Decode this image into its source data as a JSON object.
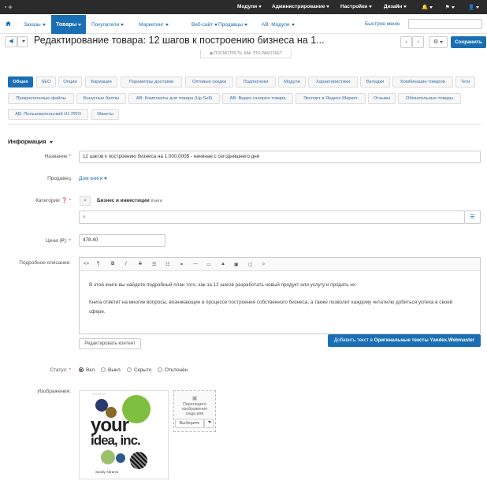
{
  "topbar": {
    "menus": [
      "Модули",
      "Администрирование",
      "Настройки",
      "Дизайн"
    ]
  },
  "navbar": {
    "items": [
      "Заказы",
      "Товары",
      "Покупатели",
      "Маркетинг",
      "Веб-сайт",
      "Продавцы",
      "AB: Модули"
    ],
    "fast_menu": "Быстрое меню"
  },
  "header": {
    "title": "Редактирование товара: 12 шагов к построению бизнеса на 1...",
    "save": "Сохранить",
    "how_it_works": "ПОСМОТРЕТЬ, КАК ЭТО РАБОТАЕТ"
  },
  "tabs_row1": [
    "Общее",
    "SEO",
    "Опции",
    "Вариации",
    "Параметры доставки",
    "Оптовые скидки",
    "Подписчики",
    "Модули",
    "Характеристики",
    "Вкладки",
    "Комбинации товаров",
    "Теги"
  ],
  "tabs_row2": [
    "Прикрепленные файлы",
    "Бонусные баллы",
    "AB: Комплекты для товара (Up Sell)",
    "AB: Видео галерея товара",
    "Экспорт в Яндекс.Маркет",
    "Отзывы",
    "Обязательные товары"
  ],
  "tabs_row3": [
    "AB: Пользовательский H1 PRO",
    "Макеты"
  ],
  "section": "Информация",
  "form": {
    "name_label": "Название",
    "name_value": "12 шагов к построению бизнеса на 1.000.000$ - начиная с сегодняшнего дня",
    "seller_label": "Продавец",
    "seller_value": "Дом книги",
    "categories_label": "Категории",
    "category_name": "Бизнес и инвестиции",
    "category_path": "Книги",
    "price_label": "Цена (₽):",
    "price_value": "478.40",
    "desc_label": "Подробное описание:",
    "desc_p1": "В этой книге вы найдете подробный план того, как за 12 шагов разработать новый продукт или услугу и продать их.",
    "desc_p2a": "Книга ответит на многие вопросы, возникающие в процессе построения собственного бизнеса, а также позволит каждому читателю добиться успеха в своей",
    "desc_p2b": "сфере.",
    "edit_content": "Редактировать контент",
    "add_text_prefix": "Добавить текст в",
    "add_text_bold": "Оригинальные тексты Yandex.Webmaster",
    "status_label": "Статус:",
    "statuses": [
      "Вкл.",
      "Выкл.",
      "Скрыто",
      "Отклонён"
    ],
    "images_label": "Изображения:",
    "drop_text": "Перетащите изображения сюда или",
    "choose": "Выберите"
  },
  "book": {
    "line1": "your",
    "line2": "idea, inc.",
    "author": "Sandy Abrams"
  },
  "colors": {
    "accent": "#1a6fb4",
    "topbar": "#2b2b2b"
  }
}
